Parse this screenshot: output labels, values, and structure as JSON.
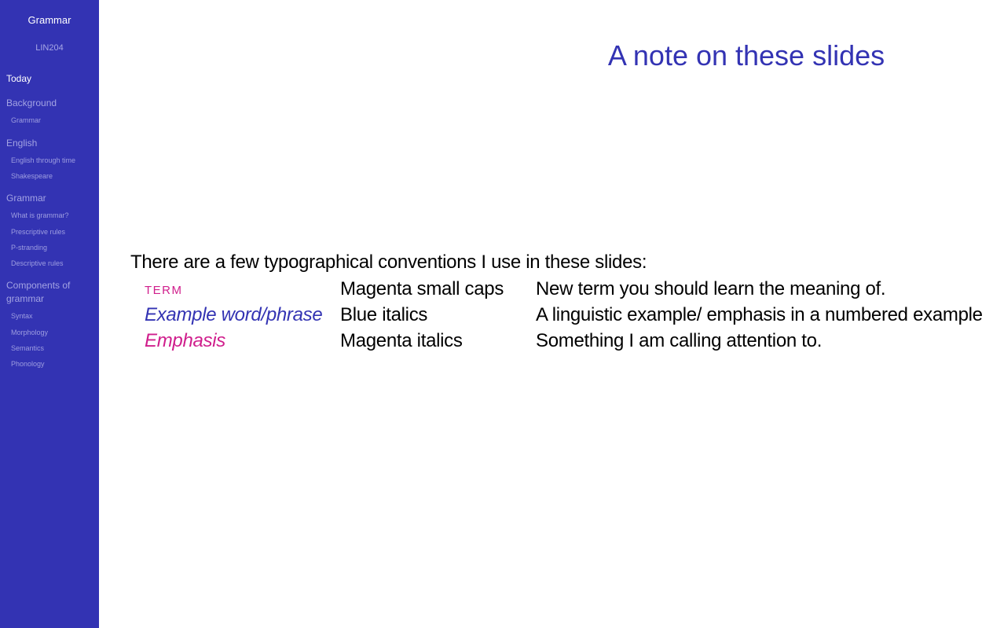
{
  "sidebar": {
    "title": "Grammar",
    "course": "LIN204",
    "sections": [
      {
        "label": "Today",
        "active": true,
        "subs": []
      },
      {
        "label": "Background",
        "active": false,
        "subs": [
          "Grammar"
        ]
      },
      {
        "label": "English",
        "active": false,
        "subs": [
          "English through time",
          "Shakespeare"
        ]
      },
      {
        "label": "Grammar",
        "active": false,
        "subs": [
          "What is grammar?",
          "Prescriptive rules",
          "P-stranding",
          "Descriptive rules"
        ]
      },
      {
        "label": "Components of grammar",
        "active": false,
        "subs": [
          "Syntax",
          "Morphology",
          "Semantics",
          "Phonology"
        ]
      }
    ]
  },
  "slide": {
    "title": "A note on these slides",
    "intro": "There are a few typographical conventions I use in these slides:",
    "conventions": [
      {
        "sample": "term",
        "style": "Magenta small caps",
        "meaning": "New term you should learn the meaning of."
      },
      {
        "sample": "Example word/phrase",
        "style": "Blue italics",
        "meaning": "A linguistic example/ emphasis in a numbered example"
      },
      {
        "sample": "Emphasis",
        "style": "Magenta italics",
        "meaning": "Something I am calling attention to."
      }
    ]
  },
  "colors": {
    "sidebar_bg": "#3333b3",
    "accent_blue": "#3333b3",
    "accent_magenta": "#d01e8c"
  }
}
